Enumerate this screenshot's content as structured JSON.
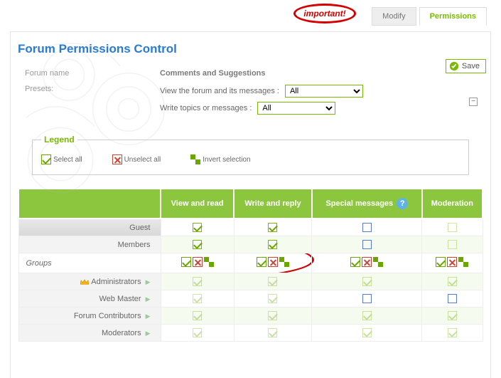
{
  "annot": {
    "important": "important!"
  },
  "tabs": {
    "modify": "Modify",
    "permissions": "Permissions"
  },
  "title": "Forum Permissions Control",
  "save_label": "Save",
  "forum_name_label": "Forum name",
  "forum_name_value": "Comments and Suggestions",
  "presets_label": "Presets:",
  "preset1_label": "View the forum and its messages :",
  "preset2_label": "Write topics or messages :",
  "preset1_value": "All",
  "preset2_value": "All",
  "legend": {
    "title": "Legend",
    "select_all": "Select all",
    "unselect_all": "Unselect all",
    "invert": "Invert selection"
  },
  "columns": {
    "c1": "View and read",
    "c2": "Write and reply",
    "c3": "Special messages",
    "c4": "Moderation"
  },
  "rows": {
    "guest": "Guest",
    "members": "Members",
    "groups": "Groups",
    "administrators": "Administrators",
    "web_master": "Web Master",
    "forum_contributors": "Forum Contributors",
    "moderators": "Moderators"
  }
}
